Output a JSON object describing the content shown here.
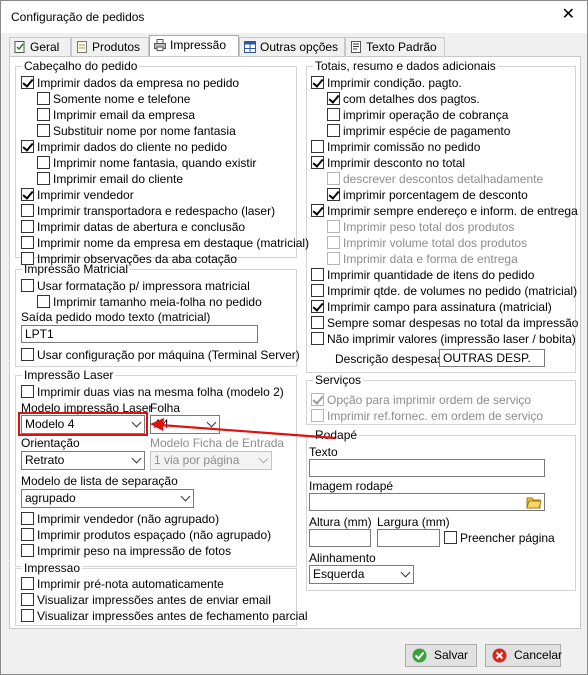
{
  "window": {
    "title": "Configuração de pedidos",
    "close_glyph": "✕"
  },
  "tabs": [
    {
      "label": "Geral",
      "icon": "document-check-icon"
    },
    {
      "label": "Produtos",
      "icon": "document-icon"
    },
    {
      "label": "Impressão",
      "icon": "printer-icon",
      "active": true
    },
    {
      "label": "Outras opções",
      "icon": "grid-icon"
    },
    {
      "label": "Texto Padrão",
      "icon": "text-doc-icon"
    }
  ],
  "cabecalho": {
    "title": "Cabeçalho do pedido",
    "items": [
      {
        "label": "Imprimir dados da empresa no pedido",
        "checked": true
      },
      {
        "label": "Somente nome e telefone",
        "checked": false
      },
      {
        "label": "Imprimir email da empresa",
        "checked": false
      },
      {
        "label": "Substituir nome por nome fantasia",
        "checked": false
      },
      {
        "label": "Imprimir dados do cliente no pedido",
        "checked": true
      },
      {
        "label": "Imprimir nome fantasia, quando existir",
        "checked": false
      },
      {
        "label": "Imprimir email do cliente",
        "checked": false
      },
      {
        "label": "Imprimir vendedor",
        "checked": true
      },
      {
        "label": "Imprimir transportadora e redespacho (laser)",
        "checked": false
      },
      {
        "label": "Imprimir datas de abertura e conclusão",
        "checked": false
      },
      {
        "label": "Imprimir nome da empresa em destaque (matricial)",
        "checked": false
      },
      {
        "label": "Imprimir observações da aba cotação",
        "checked": false
      }
    ]
  },
  "matricial": {
    "title": "Impressão Matricial",
    "usar_formatacao": {
      "label": "Usar formatação p/ impressora matricial",
      "checked": false
    },
    "meia_folha": {
      "label": "Imprimir tamanho meia-folha no pedido",
      "checked": false
    },
    "saida_label": "Saída pedido modo texto (matricial)",
    "saida_value": "LPT1",
    "config_maquina": {
      "label": "Usar configuração por máquina (Terminal Server)",
      "checked": false
    }
  },
  "laser": {
    "title": "Impressão Laser",
    "duas_vias": {
      "label": "Imprimir duas vias na mesma folha (modelo 2)",
      "checked": false
    },
    "modelo_label": "Modelo impressão Laser",
    "modelo_value": "Modelo 4",
    "folha_label": "Folha",
    "folha_value": "A4",
    "orientacao_label": "Orientação",
    "orientacao_value": "Retrato",
    "ficha_label": "Modelo Ficha de Entrada",
    "ficha_value": "1 via por página",
    "lista_label": "Modelo de lista de separação",
    "lista_value": "agrupado",
    "items": [
      {
        "label": "Imprimir vendedor (não agrupado)",
        "checked": false
      },
      {
        "label": "Imprimir produtos espaçado (não agrupado)",
        "checked": false
      },
      {
        "label": "Imprimir peso na impressão de fotos",
        "checked": false
      }
    ]
  },
  "impressao": {
    "title": "Impressao",
    "items": [
      {
        "label": "Imprimir pré-nota automaticamente",
        "checked": false
      },
      {
        "label": "Visualizar impressões antes de enviar email",
        "checked": false
      },
      {
        "label": "Visualizar impressões antes de fechamento parcial",
        "checked": false
      }
    ]
  },
  "totais": {
    "title": "Totais, resumo e dados adicionais",
    "items": [
      {
        "label": "Imprimir condição. pagto.",
        "checked": true,
        "indent": 0,
        "disabled": false
      },
      {
        "label": "com detalhes dos pagtos.",
        "checked": true,
        "indent": 1,
        "disabled": false
      },
      {
        "label": "imprimir operação de cobrança",
        "checked": false,
        "indent": 1,
        "disabled": false
      },
      {
        "label": "imprimir espécie de pagamento",
        "checked": false,
        "indent": 1,
        "disabled": false
      },
      {
        "label": "Imprimir comissão no pedido",
        "checked": false,
        "indent": 0,
        "disabled": false
      },
      {
        "label": "Imprimir desconto no total",
        "checked": true,
        "indent": 0,
        "disabled": false
      },
      {
        "label": "descrever descontos detalhadamente",
        "checked": false,
        "indent": 1,
        "disabled": true
      },
      {
        "label": "imprimir porcentagem de desconto",
        "checked": true,
        "indent": 1,
        "disabled": false
      },
      {
        "label": "Imprimir sempre endereço e inform. de entrega",
        "checked": true,
        "indent": 0,
        "disabled": false
      },
      {
        "label": "Imprimir peso total dos produtos",
        "checked": false,
        "indent": 1,
        "disabled": true
      },
      {
        "label": "Imprimir volume total dos produtos",
        "checked": false,
        "indent": 1,
        "disabled": true
      },
      {
        "label": "Imprimir data e forma de entrega",
        "checked": false,
        "indent": 1,
        "disabled": true
      },
      {
        "label": "Imprimir quantidade de itens do pedido",
        "checked": false,
        "indent": 0,
        "disabled": false
      },
      {
        "label": "Imprimir qtde. de volumes no pedido (matricial)",
        "checked": false,
        "indent": 0,
        "disabled": false
      },
      {
        "label": "Imprimir campo para assinatura (matricial)",
        "checked": true,
        "indent": 0,
        "disabled": false
      },
      {
        "label": "Sempre somar despesas no total da impressão",
        "checked": false,
        "indent": 0,
        "disabled": false
      },
      {
        "label": "Não imprimir valores (impressão laser / bobita)",
        "checked": false,
        "indent": 0,
        "disabled": false
      }
    ],
    "despesas_label": "Descrição despesas:",
    "despesas_value": "OUTRAS DESP."
  },
  "servicos": {
    "title": "Serviços",
    "items": [
      {
        "label": "Opção para imprimir ordem de serviço",
        "checked": true
      },
      {
        "label": "Imprimir ref.fornec. em ordem de serviço",
        "checked": false
      }
    ]
  },
  "rodape": {
    "title": "Rodapé",
    "texto_label": "Texto",
    "texto_value": "",
    "imagem_label": "Imagem rodapé",
    "imagem_value": "",
    "altura_label": "Altura (mm)",
    "altura_value": "",
    "largura_label": "Largura (mm)",
    "largura_value": "",
    "preencher": {
      "label": "Preencher página",
      "checked": false
    },
    "alinhamento_label": "Alinhamento",
    "alinhamento_value": "Esquerda"
  },
  "buttons": {
    "save": "Salvar",
    "cancel": "Cancelar"
  },
  "colors": {
    "highlight": "#e01010",
    "save_icon": "#3aa23a",
    "cancel_icon": "#d9261c"
  }
}
